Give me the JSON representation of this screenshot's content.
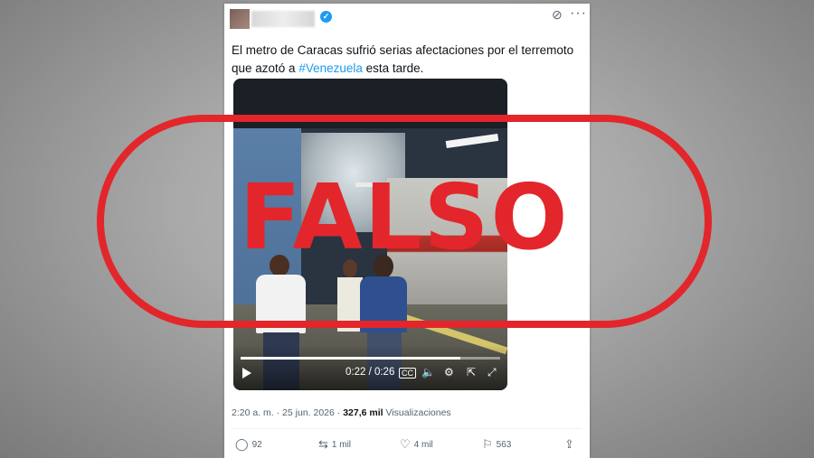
{
  "tweet": {
    "text_before": "El metro de Caracas sufrió serias afectaciones por el terremoto que azotó a ",
    "hashtag": "#Venezuela",
    "text_after": " esta tarde.",
    "time": "2:20 a. m.",
    "date": "25 jun. 2026",
    "views_count": "327,6 mil",
    "views_label": "Visualizaciones",
    "menu_icon": "more-icon",
    "grok_icon": "grok-icon"
  },
  "video": {
    "current_time": "0:22",
    "duration": "0:26",
    "time_display": "0:22 / 0:26",
    "progress": 0.846
  },
  "actions": {
    "replies": "92",
    "reposts": "1 mil",
    "likes": "4 mil",
    "bookmarks": "563"
  },
  "stamp": {
    "text": "FALSO",
    "color": "#e3262b"
  }
}
